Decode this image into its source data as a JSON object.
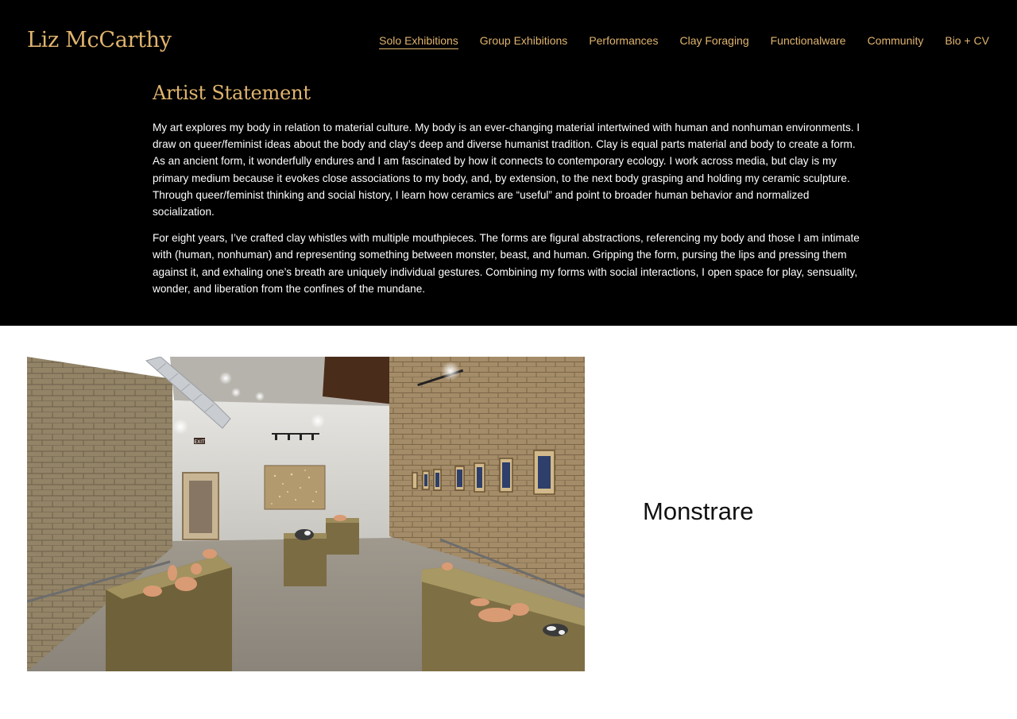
{
  "site": {
    "title": "Liz McCarthy",
    "accent_color": "#e0b46e"
  },
  "nav": {
    "items": [
      {
        "label": "Solo Exhibitions",
        "active": true
      },
      {
        "label": "Group Exhibitions",
        "active": false
      },
      {
        "label": "Performances",
        "active": false
      },
      {
        "label": "Clay Foraging",
        "active": false
      },
      {
        "label": "Functionalware",
        "active": false
      },
      {
        "label": "Community",
        "active": false
      },
      {
        "label": "Bio + CV",
        "active": false
      }
    ]
  },
  "statement": {
    "heading": "Artist Statement",
    "paragraphs": [
      "My art explores my body in relation to material culture. My body is an ever-changing material intertwined with human and nonhuman environments. I draw on queer/feminist ideas about the body and clay’s deep and diverse humanist tradition. Clay is equal parts material and body to create a form. As an ancient form, it wonderfully endures and I am fascinated by how it connects to contemporary ecology. I work across media, but clay is my primary medium because it evokes close associations to my body, and, by extension, to the next body grasping and holding my ceramic sculpture. Through queer/feminist thinking and social history, I learn how ceramics are “useful” and point to broader human behavior and normalized socialization.",
      "For eight years, I’ve crafted clay whistles with multiple mouthpieces. The forms are figural abstractions, referencing my body and those I am intimate with (human, nonhuman) and representing something between monster, beast, and human. Gripping the form, pursing the lips and pressing them against it, and exhaling one’s breath are uniquely individual gestures. Combining my forms with social interactions, I open space for play, sensuality, wonder, and liberation from the confines of the mundane."
    ]
  },
  "exhibition": {
    "title": "Monstrare",
    "exit_sign": "EXIT"
  }
}
